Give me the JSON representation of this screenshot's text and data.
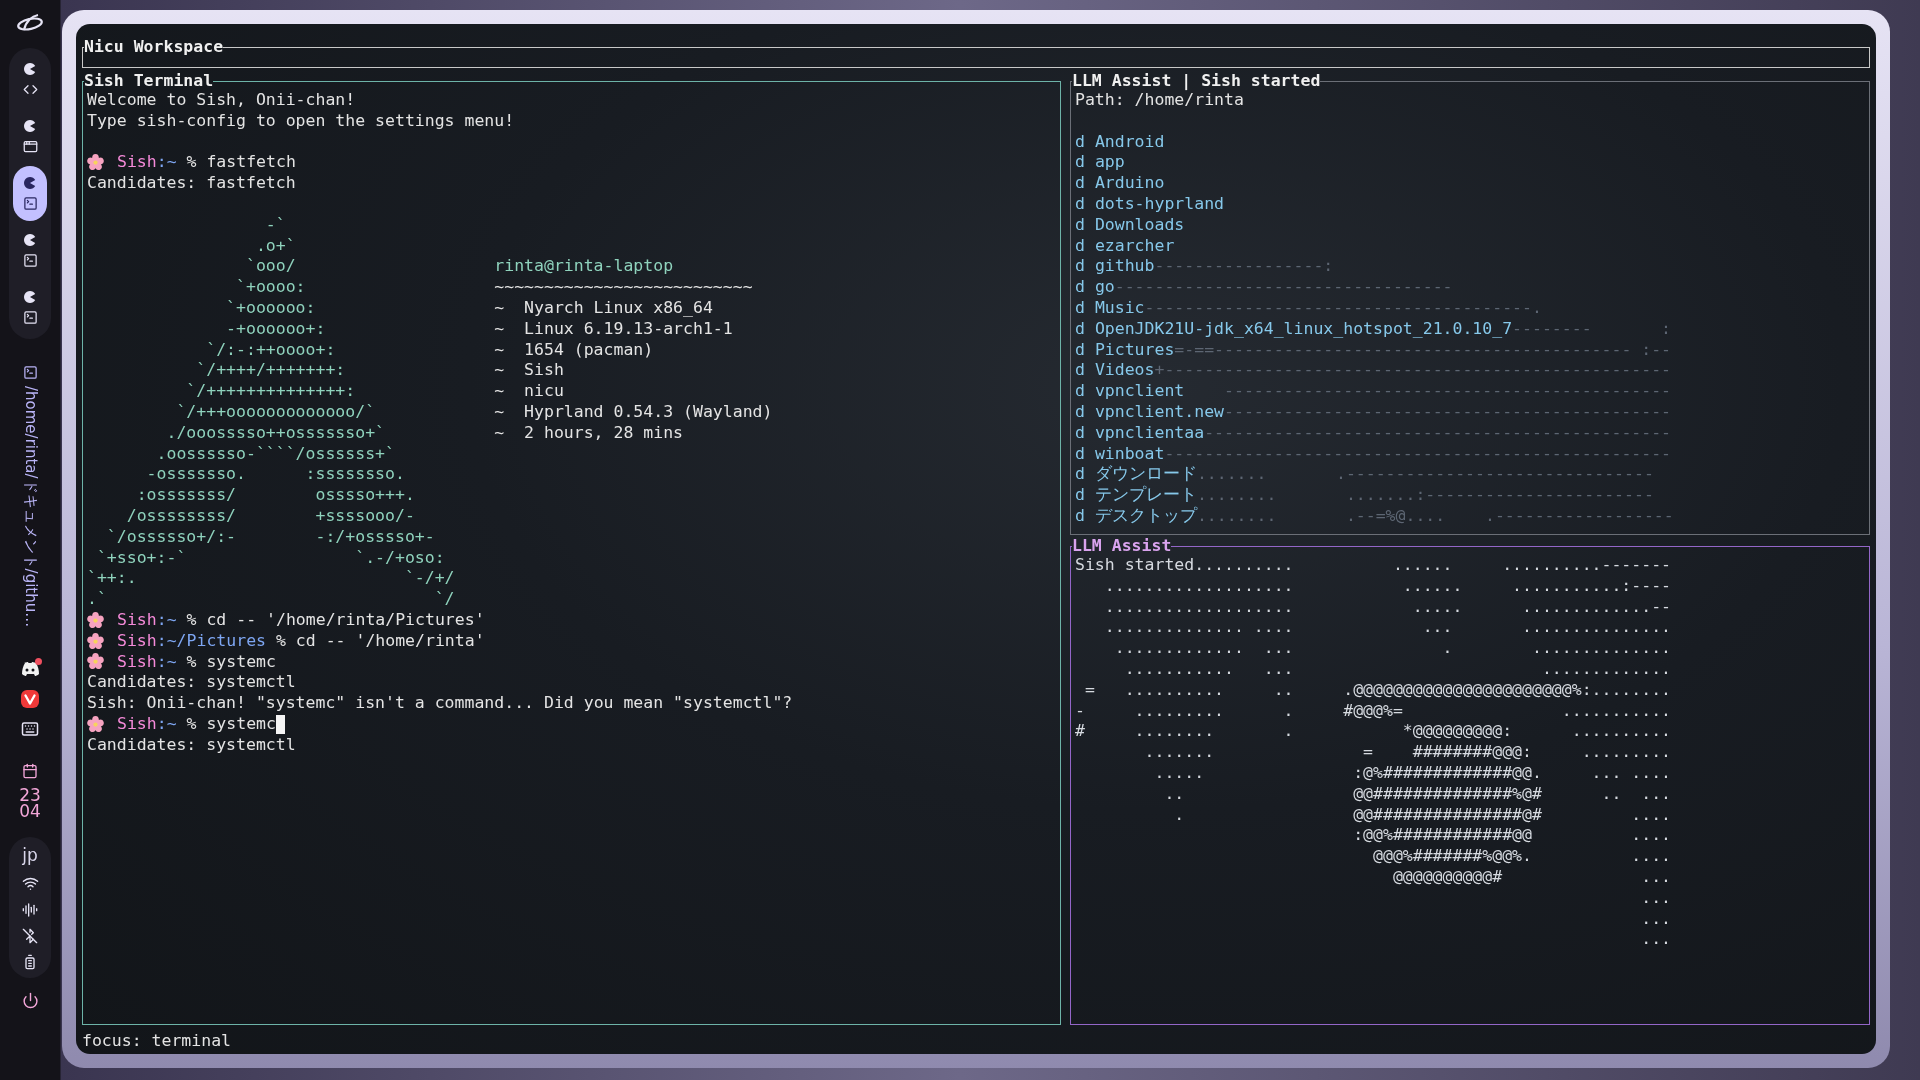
{
  "sidebar": {
    "workspaces": [
      {
        "kind": "code",
        "selected": false
      },
      {
        "kind": "window",
        "selected": false
      },
      {
        "kind": "terminal",
        "selected": true
      },
      {
        "kind": "terminal",
        "selected": false
      },
      {
        "kind": "terminal",
        "selected": false
      }
    ],
    "window_path": "/home/rinta/ドキュメント/githu…",
    "tray": [
      {
        "kind": "discord",
        "notification": true
      },
      {
        "kind": "vivaldi",
        "notification": false
      },
      {
        "kind": "keyboard",
        "notification": false
      }
    ],
    "clock": {
      "hour": "23",
      "minute": "04"
    },
    "status": {
      "language": "jp"
    }
  },
  "workspace": {
    "title": "Nicu Workspace"
  },
  "terminal": {
    "title": "Sish Terminal",
    "lines": [
      {
        "kind": "text",
        "text": "Welcome to Sish, Onii-chan!"
      },
      {
        "kind": "text",
        "text": "Type sish-config to open the settings menu!"
      },
      {
        "kind": "blank"
      },
      {
        "kind": "prompt",
        "shell": "Sish",
        "path": ":~",
        "symbol": "%",
        "command": "fastfetch",
        "cursor": false
      },
      {
        "kind": "text",
        "text": "Candidates: fastfetch"
      },
      {
        "kind": "blank"
      },
      {
        "kind": "fastfetch",
        "art": [
          "                  -`",
          "                 .o+`",
          "                `ooo/",
          "               `+oooo:",
          "              `+oooooo:",
          "              -+oooooo+:",
          "            `/:-:++oooo+:",
          "           `/++++/+++++++:",
          "          `/++++++++++++++:",
          "         `/+++ooooooooooooo/`",
          "        ./ooosssso++osssssso+`",
          "       .oossssso-````/ossssss+`",
          "      -osssssso.      :ssssssso.",
          "     :osssssss/        osssso+++.",
          "    /ossssssss/        +ssssooo/-",
          "  `/ossssso+/:-        -:/+osssso+-",
          " `+sso+:-`                 `.-/+oso:",
          "`++:.                           `-/+/",
          ".`                                 `/"
        ],
        "info": [
          {
            "kind": "host",
            "text": "rinta@rinta-laptop"
          },
          {
            "kind": "separator",
            "text": "~~~~~~~~~~~~~~~~~~~~~~~~~~"
          },
          {
            "kind": "entry",
            "text": "~  Nyarch Linux x86_64"
          },
          {
            "kind": "entry",
            "text": "~  Linux 6.19.13-arch1-1"
          },
          {
            "kind": "entry",
            "text": "~  1654 (pacman)"
          },
          {
            "kind": "entry",
            "text": "~  Sish"
          },
          {
            "kind": "entry",
            "text": "~  nicu"
          },
          {
            "kind": "entry",
            "text": "~  Hyprland 0.54.3 (Wayland)"
          },
          {
            "kind": "entry",
            "text": "~  2 hours, 28 mins"
          }
        ]
      },
      {
        "kind": "prompt",
        "shell": "Sish",
        "path": ":~",
        "symbol": "%",
        "command": "cd -- '/home/rinta/Pictures'",
        "cursor": false
      },
      {
        "kind": "prompt",
        "shell": "Sish",
        "path": ":~/Pictures",
        "symbol": "%",
        "command": "cd -- '/home/rinta'",
        "cursor": false
      },
      {
        "kind": "prompt",
        "shell": "Sish",
        "path": ":~",
        "symbol": "%",
        "command": "systemc",
        "cursor": false
      },
      {
        "kind": "text",
        "text": "Candidates: systemctl"
      },
      {
        "kind": "text",
        "text": "Sish: Onii-chan! \"systemc\" isn't a command... Did you mean \"systemctl\"?"
      },
      {
        "kind": "prompt",
        "shell": "Sish",
        "path": ":~",
        "symbol": "%",
        "command": "systemc",
        "cursor": true
      },
      {
        "kind": "text",
        "text": "Candidates: systemctl"
      }
    ]
  },
  "files": {
    "title": "LLM Assist | Sish started",
    "path": "Path: /home/rinta",
    "entries": [
      {
        "type": "d",
        "name": "Android"
      },
      {
        "type": "d",
        "name": "app"
      },
      {
        "type": "d",
        "name": "Arduino"
      },
      {
        "type": "d",
        "name": "dots-hyprland"
      },
      {
        "type": "d",
        "name": "Downloads"
      },
      {
        "type": "d",
        "name": "ezarcher"
      },
      {
        "type": "d",
        "name": "github",
        "trail": "-----------------:"
      },
      {
        "type": "d",
        "name": "go",
        "trail": "----------------------------------"
      },
      {
        "type": "d",
        "name": "Music",
        "trail": "---------------------------------------."
      },
      {
        "type": "d",
        "name": "OpenJDK21U-jdk_x64_linux_hotspot_21.0.10_7",
        "trail": "--------       :"
      },
      {
        "type": "d",
        "name": "Pictures",
        "trail": "=-==------------------------------------------ :--"
      },
      {
        "type": "d",
        "name": "Videos",
        "trail": "+---------------------------------------------------"
      },
      {
        "type": "d",
        "name": "vpnclient",
        "trail": "    ---------------------------------------------"
      },
      {
        "type": "d",
        "name": "vpnclient.new",
        "trail": "---------------------------------------------"
      },
      {
        "type": "d",
        "name": "vpnclientaa",
        "trail": "-----------------------------------------------"
      },
      {
        "type": "d",
        "name": "winboat",
        "trail": "---------------------------------------------------"
      },
      {
        "type": "d",
        "name": "ダウンロード",
        "trail": ".......       .-------------------------------"
      },
      {
        "type": "d",
        "name": "テンプレート",
        "trail": "........       .......:-----------------------"
      },
      {
        "type": "d",
        "name": "デスクトップ",
        "trail": "........       .--=%@....    .------------------"
      }
    ]
  },
  "assist": {
    "title": "LLM Assist",
    "lines": [
      "Sish started..........          ......     ..........-------",
      "   ...................           ......     ...........:----",
      "   ...................            .....      .............--",
      "   .............. ....             ...       ...............",
      "    .............  ...               .        ..............",
      "     ...........   ...                         .............",
      " =   ..........     ..     .@@@@@@@@@@@@@@@@@@@@@@%:........",
      "-     .........      .     #@@@%=                ...........",
      "#     ........       .           *@@@@@@@@@:      ..........",
      "       .......               =    ########@@@:     .........",
      "        .....               :@%#############@@.     ... ....",
      "         ..                 @@##############%@#      ..  ...",
      "          .                 @@###############@#         ....",
      "                            :@@%############@@          ....",
      "                              @@@%#######%@@%.          ....",
      "                                @@@@@@@@@@#              ...",
      "                                                         ...",
      "                                                         ...",
      "                                                         ..."
    ]
  },
  "status_bar": {
    "text": "focus: terminal"
  }
}
